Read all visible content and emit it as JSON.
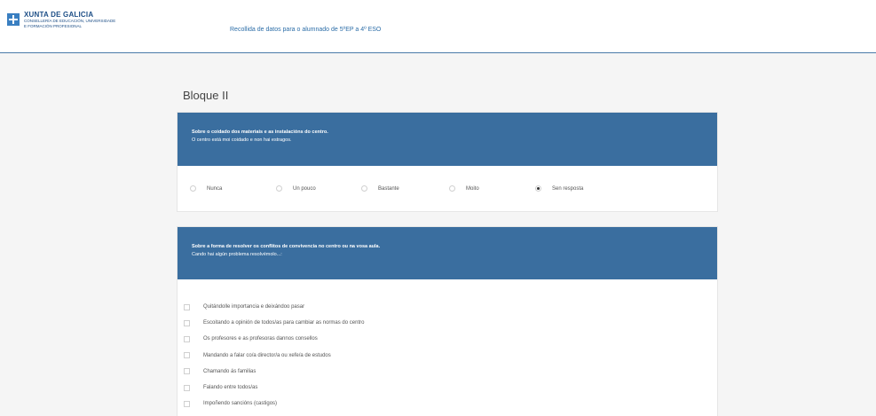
{
  "header": {
    "logo_title": "XUNTA DE GALICIA",
    "logo_subtitle_1": "CONSELLERÍA DE EDUCACIÓN, UNIVERSIDADE",
    "logo_subtitle_2": "E FORMACIÓN PROFESIONAL",
    "title": "Recollida de datos para o alumnado de 5ºEP a 4º ESO"
  },
  "page_title": "Bloque II",
  "question1": {
    "heading": "Sobre o coidado dos materiais e as instalacións do centro.",
    "text": "O centro está moi coidado e non hai estragos.",
    "options": [
      {
        "label": "Nunca",
        "checked": false
      },
      {
        "label": "Un pouco",
        "checked": false
      },
      {
        "label": "Bastante",
        "checked": false
      },
      {
        "label": "Moito",
        "checked": false
      },
      {
        "label": "Sen resposta",
        "checked": true
      }
    ]
  },
  "question2": {
    "heading": "Sobre a forma de resolver os conflitos de convivencia no centro ou na vosa aula.",
    "text": "Cando hai algún problema resolvémolo...:",
    "options": [
      "Quitándolle importancia e deixándoo pasar",
      "Escoitando a opinión de todos/as para cambiar as normas do centro",
      "Os profesores e as profesoras dannos consellos",
      "Mandando a falar co/a director/a ou xefe/a de estudos",
      "Chamando ás familias",
      "Falando entre todos/as",
      "Impoñendo sancións (castigos)"
    ]
  },
  "colors": {
    "header_bar": "#3a6e9f",
    "link": "#2d6ea8",
    "brand": "#1d4e86"
  }
}
